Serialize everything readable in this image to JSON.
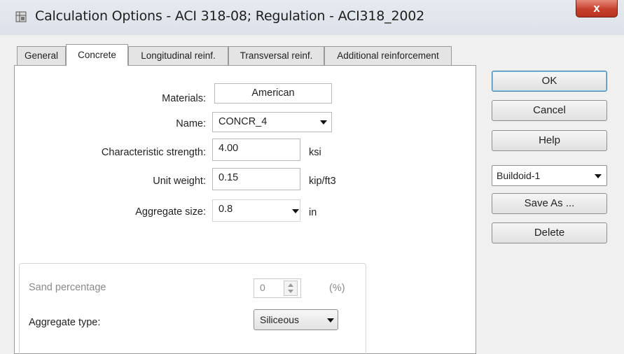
{
  "window": {
    "title": "Calculation Options - ACI 318-08;  Regulation - ACI318_2002",
    "close_label": "x"
  },
  "tabs": [
    {
      "label": "General",
      "active": false
    },
    {
      "label": "Concrete",
      "active": true
    },
    {
      "label": "Longitudinal reinf.",
      "active": false
    },
    {
      "label": "Transversal reinf.",
      "active": false
    },
    {
      "label": "Additional reinforcement",
      "active": false
    }
  ],
  "concrete": {
    "materials_label": "Materials:",
    "materials_value": "American",
    "name_label": "Name:",
    "name_value": "CONCR_4",
    "strength_label": "Characteristic strength:",
    "strength_value": "4.00",
    "strength_unit": "ksi",
    "unit_weight_label": "Unit weight:",
    "unit_weight_value": "0.15",
    "unit_weight_unit": "kip/ft3",
    "aggregate_size_label": "Aggregate size:",
    "aggregate_size_value": "0.8",
    "aggregate_size_unit": "in",
    "sand_label": "Sand percentage",
    "sand_value": "0",
    "sand_unit": "(%)",
    "aggregate_type_label": "Aggregate type:",
    "aggregate_type_value": "Siliceous"
  },
  "side": {
    "ok_label": "OK",
    "cancel_label": "Cancel",
    "help_label": "Help",
    "preset_value": "Buildoid-1",
    "save_as_label": "Save As ...",
    "delete_label": "Delete"
  }
}
